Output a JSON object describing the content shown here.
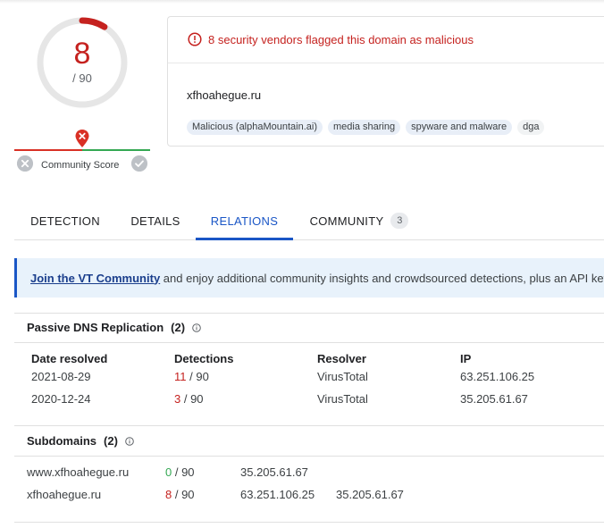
{
  "score": {
    "detections": "8",
    "total": "/ 90",
    "fraction": 0.0889,
    "color": "#c5221f"
  },
  "community": {
    "label": "Community Score",
    "pin_icon": "map-pin-x-icon",
    "vote_down_icon": "close-circle-icon",
    "vote_up_icon": "check-circle-icon"
  },
  "alert": {
    "icon": "error-circle-icon",
    "text": "8 security vendors flagged this domain as malicious"
  },
  "domain": "xfhoahegue.ru",
  "tags": [
    "Malicious (alphaMountain.ai)",
    "media sharing",
    "spyware and malware",
    "dga"
  ],
  "tabs": [
    {
      "label": "DETECTION"
    },
    {
      "label": "DETAILS"
    },
    {
      "label": "RELATIONS",
      "active": true
    },
    {
      "label": "COMMUNITY",
      "badge": "3"
    }
  ],
  "banner": {
    "link": "Join the VT Community",
    "text": " and enjoy additional community insights and crowdsourced detections, plus an API key"
  },
  "passive_dns": {
    "title": "Passive DNS Replication",
    "count": "(2)",
    "columns": [
      "Date resolved",
      "Detections",
      "Resolver",
      "IP"
    ],
    "rows": [
      {
        "date": "2021-08-29",
        "det": "11",
        "total": " / 90",
        "resolver": "VirusTotal",
        "ip": "63.251.106.25"
      },
      {
        "date": "2020-12-24",
        "det": "3",
        "total": " / 90",
        "resolver": "VirusTotal",
        "ip": "35.205.61.67"
      }
    ]
  },
  "subdomains": {
    "title": "Subdomains",
    "count": "(2)",
    "rows": [
      {
        "domain": "www.xfhoahegue.ru",
        "det": "0",
        "total": " / 90",
        "ip1": "35.205.61.67",
        "ip2": ""
      },
      {
        "domain": "xfhoahegue.ru",
        "det": "8",
        "total": " / 90",
        "ip1": "63.251.106.25",
        "ip2": "35.205.61.67"
      }
    ]
  },
  "colors": {
    "malicious": "#c5221f",
    "clean": "#34a853",
    "accent": "#1a56c6"
  }
}
